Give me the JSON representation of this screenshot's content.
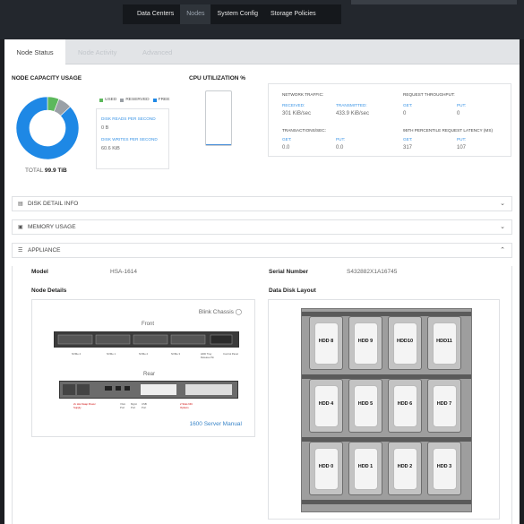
{
  "top_nav": {
    "items": [
      {
        "label": "Data Centers",
        "active": false
      },
      {
        "label": "Nodes",
        "active": true
      },
      {
        "label": "System Config",
        "active": false
      },
      {
        "label": "Storage Policies",
        "active": false
      }
    ]
  },
  "tabs": [
    {
      "label": "Node Status",
      "active": true
    },
    {
      "label": "Node Activity",
      "active": false
    },
    {
      "label": "Advanced",
      "active": false
    }
  ],
  "capacity": {
    "title": "NODE CAPACITY USAGE",
    "legend": [
      {
        "label": "USED",
        "color": "#5cb85c"
      },
      {
        "label": "RESERVED",
        "color": "#9aa0a6"
      },
      {
        "label": "FREE",
        "color": "#1e88e5"
      }
    ],
    "chart_data": {
      "type": "pie",
      "categories": [
        "USED",
        "RESERVED",
        "FREE"
      ],
      "values": [
        6,
        7,
        87
      ]
    },
    "total_label": "TOTAL",
    "total_value": "99.9 TiB",
    "disk_reads_label": "DISK READS PER SECOND",
    "disk_reads_value": "0 B",
    "disk_writes_label": "DISK WRITES PER SECOND",
    "disk_writes_value": "60.6 KiB"
  },
  "cpu": {
    "title": "CPU UTILIZATION %",
    "value_fraction": 0.01
  },
  "stats": {
    "network_title": "NETWORK TRAFFIC:",
    "received_label": "RECEIVED:",
    "received_value": "301 KiB/sec",
    "transmitted_label": "TRANSMITTED:",
    "transmitted_value": "433.9 KiB/sec",
    "throughput_title": "REQUEST THROUGHPUT:",
    "tp_get_label": "GET:",
    "tp_get_value": "0",
    "tp_put_label": "PUT:",
    "tp_put_value": "0",
    "transactions_title": "TRANSACTIONS/SEC:",
    "tr_get_label": "GET:",
    "tr_get_value": "0.0",
    "tr_put_label": "PUT:",
    "tr_put_value": "0.0",
    "latency_title": "95TH PERCENTILE REQUEST LATENCY (MS)",
    "lat_get_label": "GET:",
    "lat_get_value": "317",
    "lat_put_label": "PUT:",
    "lat_put_value": "107"
  },
  "sections": {
    "disk_detail": "DISK DETAIL INFO",
    "memory_usage": "MEMORY USAGE",
    "appliance": "APPLIANCE"
  },
  "appliance": {
    "model_label": "Model",
    "model_value": "HSA-1614",
    "serial_label": "Serial Number",
    "serial_value": "S432882X1A16745",
    "node_details_label": "Node Details",
    "disk_layout_label": "Data Disk Layout",
    "blink_chassis": "Blink Chassis",
    "manual_link": "1600 Server Manual",
    "front_label": "Front",
    "rear_label": "Rear",
    "front_callouts": [
      "NVMe 4",
      "NVMe 1",
      "NVMe 2",
      "NVMe 3",
      "HDD Tray Release Pin",
      "Control Panel"
    ],
    "rear_callouts": [
      "2x Hot-Swap Power Supply",
      "VGA Port",
      "Mgmt Port",
      "USB Port",
      "2 Slots NIC Options"
    ],
    "disks": [
      "HDD 8",
      "HDD 9",
      "HDD10",
      "HDD11",
      "HDD 4",
      "HDD 5",
      "HDD 6",
      "HDD 7",
      "HDD 0",
      "HDD 1",
      "HDD  2",
      "HDD  3"
    ]
  }
}
